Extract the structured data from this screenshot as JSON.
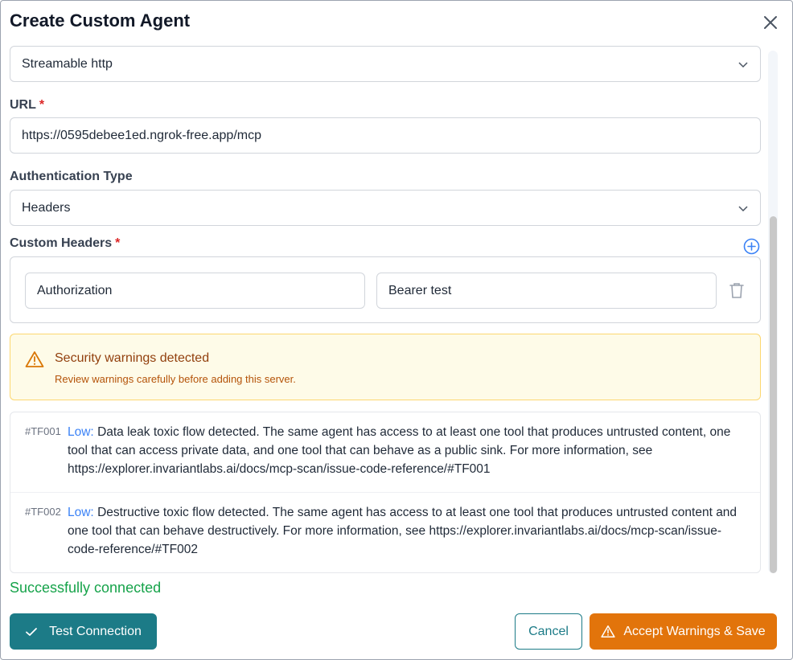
{
  "dialog": {
    "title": "Create Custom Agent"
  },
  "transport": {
    "selected": "Streamable http"
  },
  "url": {
    "label": "URL",
    "required_mark": "*",
    "value": "https://0595debee1ed.ngrok-free.app/mcp"
  },
  "auth": {
    "label": "Authentication Type",
    "selected": "Headers"
  },
  "custom_headers": {
    "label": "Custom Headers",
    "required_mark": "*",
    "rows": [
      {
        "key": "Authorization",
        "value": "Bearer test"
      }
    ]
  },
  "warning": {
    "title": "Security warnings detected",
    "subtitle": "Review warnings carefully before adding this server."
  },
  "issues": [
    {
      "code": "#TF001",
      "severity": "Low:",
      "message": "Data leak toxic flow detected. The same agent has access to at least one tool that produces untrusted content, one tool that can access private data, and one tool that can behave as a public sink. For more information, see https://explorer.invariantlabs.ai/docs/mcp-scan/issue-code-reference/#TF001"
    },
    {
      "code": "#TF002",
      "severity": "Low:",
      "message": "Destructive toxic flow detected. The same agent has access to at least one tool that produces untrusted content and one tool that can behave destructively. For more information, see https://explorer.invariantlabs.ai/docs/mcp-scan/issue-code-reference/#TF002"
    }
  ],
  "status": {
    "message": "Successfully connected"
  },
  "footer": {
    "test_label": "Test Connection",
    "cancel_label": "Cancel",
    "accept_label": "Accept Warnings & Save"
  },
  "colors": {
    "primary": "#1c7b87",
    "accent": "#e2740b",
    "success": "#16a34a",
    "severity_low": "#3b82f6",
    "required": "#dc2626"
  },
  "icons": {
    "close": "close-icon",
    "chevron": "chevron-down-icon",
    "add": "plus-circle-icon",
    "delete": "trash-icon",
    "warning": "warning-triangle-icon",
    "check": "check-icon"
  }
}
